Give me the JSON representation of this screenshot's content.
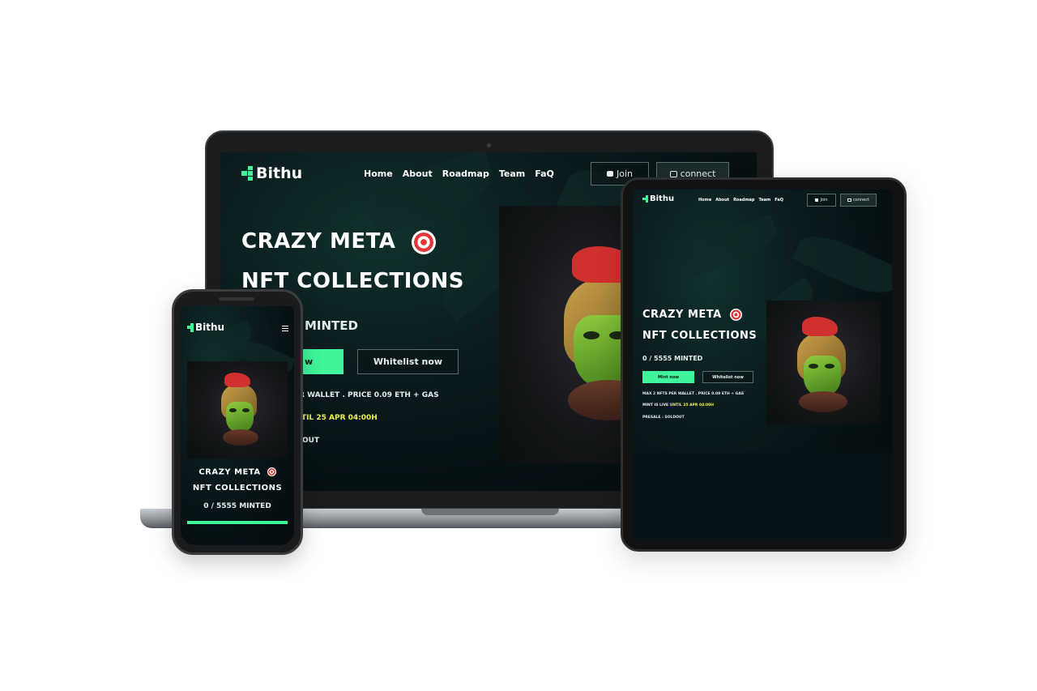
{
  "brand": {
    "name": "Bithu",
    "accent": "#3ff49a",
    "highlight": "#f2f24a",
    "background": "#071114"
  },
  "nav": {
    "items": [
      "Home",
      "About",
      "Roadmap",
      "Team",
      "FaQ"
    ]
  },
  "header": {
    "join_label": "Join",
    "connect_label": "connect",
    "join_icon": "discord-icon",
    "connect_icon": "wallet-icon",
    "menu_icon": "hamburger-menu-icon"
  },
  "hero": {
    "title_line1": "CRAZY META",
    "title_icon": "target-emoji-icon",
    "title_line2": "NFT COLLECTIONS",
    "minted": "0 / 5555 MINTED",
    "mint_button": "Mint now",
    "whitelist_button": "Whitelist now",
    "wallet_info": "MAX 2 NFTS PER WALLET . PRICE 0.09 ETH + GAS",
    "mint_live_prefix": "MINT IS LIVE",
    "mint_live_until": "UNTIL 25 APR 04:00H",
    "presale": "PRESALE : SOLDOUT"
  },
  "laptop_visible": {
    "minted_fragment": "MINTED",
    "mint_button_fragment": "w",
    "wallet_fragment": "R WALLET . PRICE 0.09 ETH + GAS",
    "until_fragment": "TIL 25 APR 04:00H",
    "presale_fragment": "OUT"
  }
}
